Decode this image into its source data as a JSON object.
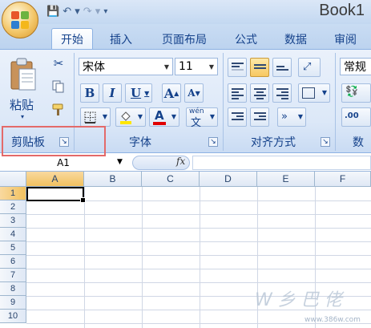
{
  "window": {
    "title": "Book1"
  },
  "qat": {
    "save": "💾",
    "undo": "↶ ▾",
    "redo": "↷ ▾",
    "more": "▾"
  },
  "tabs": [
    "开始",
    "插入",
    "页面布局",
    "公式",
    "数据",
    "审阅"
  ],
  "ribbon": {
    "clipboard": {
      "paste_label": "粘贴",
      "paste_dd": "▾",
      "group_label": "剪贴板"
    },
    "font": {
      "font_name": "宋体",
      "font_size": "11",
      "bold": "B",
      "italic": "I",
      "underline": "U",
      "grow": "A",
      "shrink": "A",
      "phonetic": "wén",
      "group_label": "字体"
    },
    "alignment": {
      "group_label": "对齐方式"
    },
    "number": {
      "format": "常规",
      "group_label": "数"
    }
  },
  "formula_bar": {
    "name_box": "A1",
    "fx": "fx",
    "content": ""
  },
  "grid": {
    "columns": [
      "A",
      "B",
      "C",
      "D",
      "E",
      "F"
    ],
    "rows": [
      "1",
      "2",
      "3",
      "4",
      "5",
      "6",
      "7",
      "8",
      "9",
      "10"
    ],
    "selected": "A1"
  },
  "watermark": {
    "text": "W 乡 巴 佬",
    "url": "www.386w.com"
  },
  "colors": {
    "highlight_box": "#e36a6a",
    "active_header": "#f1c15f"
  }
}
